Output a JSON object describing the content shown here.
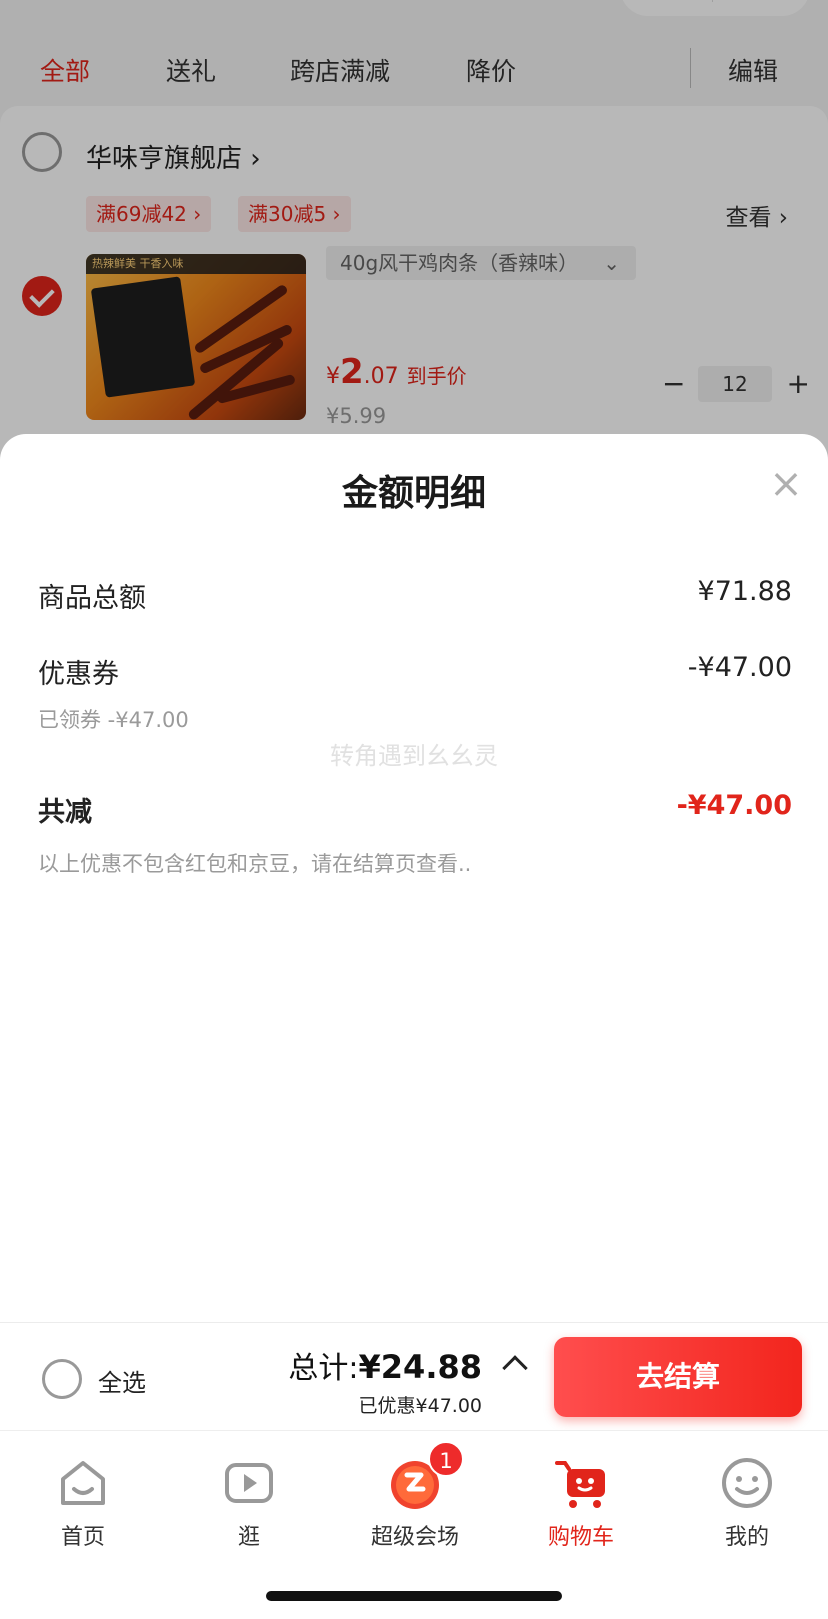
{
  "filters": {
    "tabs": [
      {
        "label": "全部",
        "active": true
      },
      {
        "label": "送礼"
      },
      {
        "label": "跨店满减"
      },
      {
        "label": "降价"
      }
    ],
    "edit_label": "编辑"
  },
  "store": {
    "name": "华味亨旗舰店",
    "promos": [
      "满69减42",
      "满30减5"
    ],
    "view_label": "查看",
    "product": {
      "image_banner": "热辣鲜美 干香入味",
      "variant": "40g风干鸡肉条（香辣味）",
      "price_currency": "¥",
      "price_int": "2",
      "price_dec": ".07",
      "price_tag": "到手价",
      "price_old": "¥5.99",
      "quantity": "12",
      "checked": true
    }
  },
  "sheet": {
    "title": "金额明细",
    "close_icon": "×",
    "rows": {
      "subtotal_label": "商品总额",
      "subtotal_value": "¥71.88",
      "coupon_label": "优惠券",
      "coupon_value": "-¥47.00",
      "coupon_sub": "已领券 -¥47.00",
      "discount_label": "共减",
      "discount_value": "-¥47.00",
      "note": "以上优惠不包含红包和京豆，请在结算页查看.."
    },
    "watermark": "转角遇到幺幺灵"
  },
  "checkout": {
    "select_all": "全选",
    "total_prefix": "总计:",
    "total_amount": "¥24.88",
    "saved": "已优惠¥47.00",
    "button": "去结算"
  },
  "tabbar": {
    "items": [
      {
        "label": "首页",
        "icon": "home-icon"
      },
      {
        "label": "逛",
        "icon": "video-play-icon"
      },
      {
        "label": "超级会场",
        "icon": "super-venue-icon",
        "badge": "1"
      },
      {
        "label": "购物车",
        "icon": "cart-icon",
        "active": true
      },
      {
        "label": "我的",
        "icon": "smiley-icon"
      }
    ]
  },
  "colors": {
    "accent": "#e1251b",
    "button_gradient_start": "#ff4e4e",
    "button_gradient_end": "#f2251d"
  }
}
